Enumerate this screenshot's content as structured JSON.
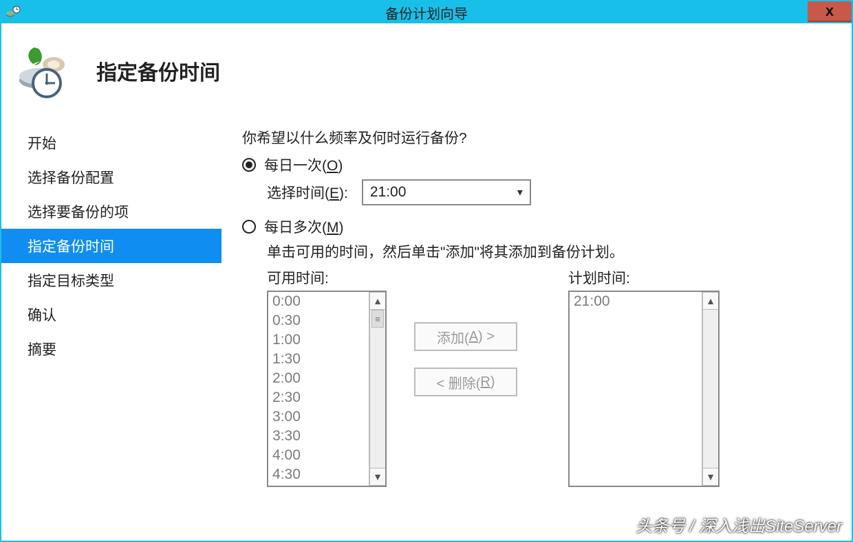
{
  "titlebar": {
    "title": "备份计划向导",
    "close": "x"
  },
  "header": {
    "title": "指定备份时间"
  },
  "sidebar": {
    "items": [
      {
        "label": "开始",
        "selected": false
      },
      {
        "label": "选择备份配置",
        "selected": false
      },
      {
        "label": "选择要备份的项",
        "selected": false
      },
      {
        "label": "指定备份时间",
        "selected": true
      },
      {
        "label": "指定目标类型",
        "selected": false
      },
      {
        "label": "确认",
        "selected": false
      },
      {
        "label": "摘要",
        "selected": false
      }
    ]
  },
  "main": {
    "question": "你希望以什么频率及何时运行备份?",
    "option_once": {
      "prefix": "每日一次(",
      "key": "O",
      "suffix": ")"
    },
    "option_many": {
      "prefix": "每日多次(",
      "key": "M",
      "suffix": ")"
    },
    "select_time": {
      "label_prefix": "选择时间(",
      "label_key": "E",
      "label_suffix": "):",
      "value": "21:00"
    },
    "instruction": "单击可用的时间，然后单击\"添加\"将其添加到备份计划。",
    "available_label": "可用时间:",
    "planned_label": "计划时间:",
    "available_times": [
      "0:00",
      "0:30",
      "1:00",
      "1:30",
      "2:00",
      "2:30",
      "3:00",
      "3:30",
      "4:00",
      "4:30"
    ],
    "planned_times": [
      "21:00"
    ],
    "add_btn": {
      "prefix": "添加(",
      "key": "A",
      "suffix": ") >"
    },
    "remove_btn": {
      "prefix": "< 删除(",
      "key": "R",
      "suffix": ")"
    }
  },
  "watermark": "头条号 / 深入浅出SiteServer"
}
